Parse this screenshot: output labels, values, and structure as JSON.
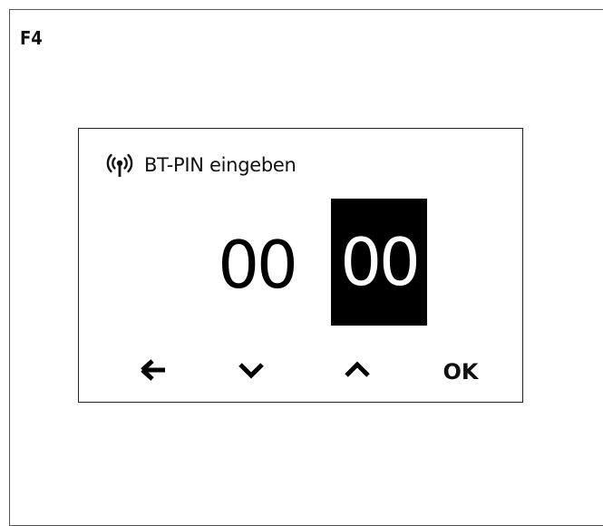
{
  "figure": {
    "label": "F4"
  },
  "screen": {
    "icon": "bluetooth-signal-icon",
    "title": "BT-PIN eingeben",
    "pin": {
      "first_pair": "00",
      "second_pair": "00",
      "selected": "second_pair"
    },
    "controls": {
      "back_icon": "arrow-left-icon",
      "down_icon": "chevron-down-icon",
      "up_icon": "chevron-up-icon",
      "ok_label": "OK"
    }
  }
}
